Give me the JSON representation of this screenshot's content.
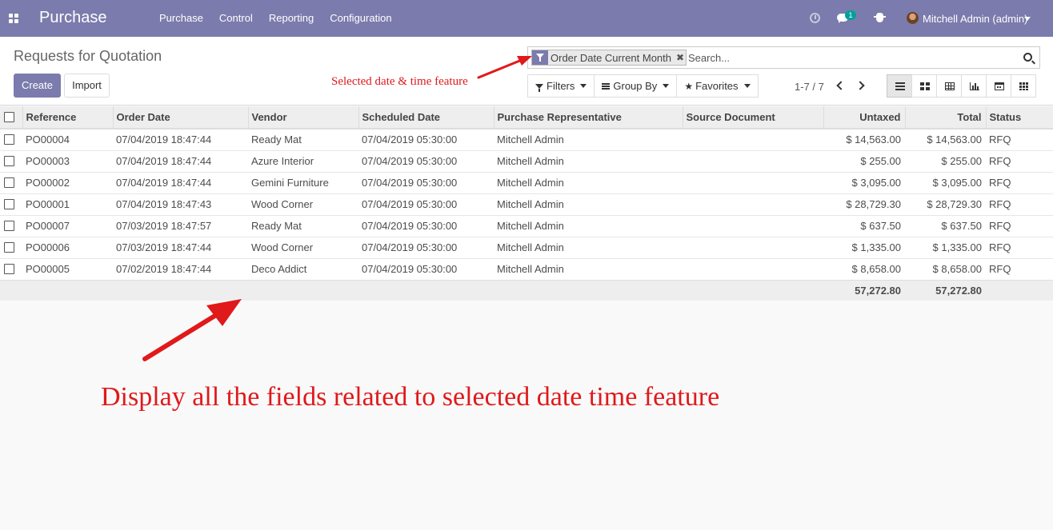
{
  "navbar": {
    "brand": "Purchase",
    "menu": [
      "Purchase",
      "Control",
      "Reporting",
      "Configuration"
    ],
    "chat_count": "1",
    "user": "Mitchell Admin (admin)",
    "accent_color": "#7c7bad"
  },
  "control_panel": {
    "breadcrumb": "Requests for Quotation",
    "create_label": "Create",
    "import_label": "Import",
    "facet_label": "Order Date Current Month",
    "search_placeholder": "Search...",
    "filters_label": "Filters",
    "groupby_label": "Group By",
    "favorites_label": "Favorites",
    "pager": "1-7 / 7",
    "views": [
      "list",
      "kanban",
      "pivot",
      "graph",
      "calendar",
      "grid"
    ],
    "active_view": "list"
  },
  "annotations": {
    "small": "Selected date & time feature",
    "big": "Display all the fields related to selected date time feature",
    "color": "#e0191b"
  },
  "table": {
    "headers": [
      "Reference",
      "Order Date",
      "Vendor",
      "Scheduled Date",
      "Purchase Representative",
      "Source Document",
      "Untaxed",
      "Total",
      "Status"
    ],
    "rows": [
      [
        "PO00004",
        "07/04/2019 18:47:44",
        "Ready Mat",
        "07/04/2019 05:30:00",
        "Mitchell Admin",
        "",
        "$ 14,563.00",
        "$ 14,563.00",
        "RFQ"
      ],
      [
        "PO00003",
        "07/04/2019 18:47:44",
        "Azure Interior",
        "07/04/2019 05:30:00",
        "Mitchell Admin",
        "",
        "$ 255.00",
        "$ 255.00",
        "RFQ"
      ],
      [
        "PO00002",
        "07/04/2019 18:47:44",
        "Gemini Furniture",
        "07/04/2019 05:30:00",
        "Mitchell Admin",
        "",
        "$ 3,095.00",
        "$ 3,095.00",
        "RFQ"
      ],
      [
        "PO00001",
        "07/04/2019 18:47:43",
        "Wood Corner",
        "07/04/2019 05:30:00",
        "Mitchell Admin",
        "",
        "$ 28,729.30",
        "$ 28,729.30",
        "RFQ"
      ],
      [
        "PO00007",
        "07/03/2019 18:47:57",
        "Ready Mat",
        "07/04/2019 05:30:00",
        "Mitchell Admin",
        "",
        "$ 637.50",
        "$ 637.50",
        "RFQ"
      ],
      [
        "PO00006",
        "07/03/2019 18:47:44",
        "Wood Corner",
        "07/04/2019 05:30:00",
        "Mitchell Admin",
        "",
        "$ 1,335.00",
        "$ 1,335.00",
        "RFQ"
      ],
      [
        "PO00005",
        "07/02/2019 18:47:44",
        "Deco Addict",
        "07/04/2019 05:30:00",
        "Mitchell Admin",
        "",
        "$ 8,658.00",
        "$ 8,658.00",
        "RFQ"
      ]
    ],
    "totals": {
      "untaxed": "57,272.80",
      "total": "57,272.80"
    }
  }
}
